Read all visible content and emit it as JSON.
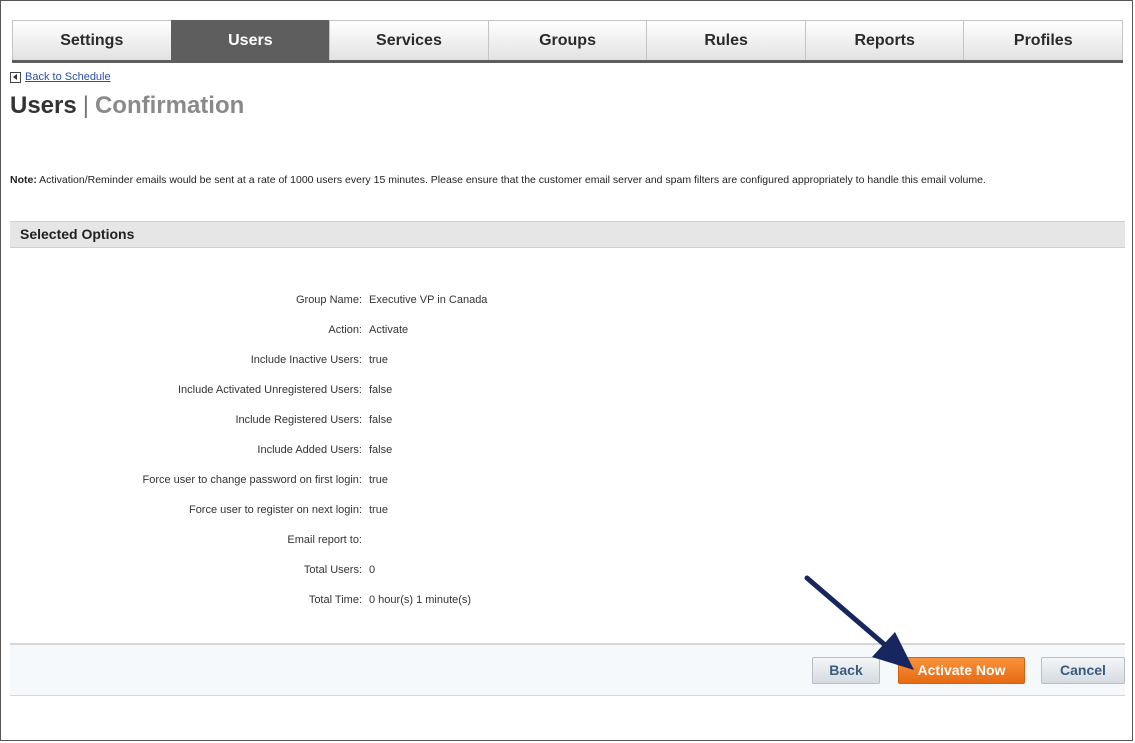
{
  "nav": {
    "tabs": [
      {
        "label": "Settings",
        "active": false
      },
      {
        "label": "Users",
        "active": true
      },
      {
        "label": "Services",
        "active": false
      },
      {
        "label": "Groups",
        "active": false
      },
      {
        "label": "Rules",
        "active": false
      },
      {
        "label": "Reports",
        "active": false
      },
      {
        "label": "Profiles",
        "active": false
      }
    ]
  },
  "page": {
    "back_link": "Back to Schedule",
    "title": "Users",
    "title_separator": "|",
    "subtitle": "Confirmation"
  },
  "note": {
    "label": "Note:",
    "text": " Activation/Reminder emails would be sent at a rate of 1000 users every 15 minutes. Please ensure that the customer email server and spam filters are configured appropriately to handle this email volume."
  },
  "selected_options": {
    "header": "Selected Options",
    "rows": [
      {
        "label": "Group Name:",
        "value": "Executive VP in Canada"
      },
      {
        "label": "Action:",
        "value": "Activate"
      },
      {
        "label": "Include Inactive Users:",
        "value": "true"
      },
      {
        "label": "Include Activated Unregistered Users:",
        "value": "false"
      },
      {
        "label": "Include Registered Users:",
        "value": "false"
      },
      {
        "label": "Include Added Users:",
        "value": "false"
      },
      {
        "label": "Force user to change password on first login:",
        "value": "true"
      },
      {
        "label": "Force user to register on next login:",
        "value": "true"
      },
      {
        "label": "Email report to:",
        "value": ""
      },
      {
        "label": "Total Users:",
        "value": "0"
      },
      {
        "label": "Total Time:",
        "value": "0 hour(s) 1 minute(s)"
      }
    ]
  },
  "actions": {
    "back_label": "Back",
    "activate_label": "Activate Now",
    "cancel_label": "Cancel"
  },
  "colors": {
    "active_tab": "#5e5e5e",
    "primary_button": "#f07c26",
    "arrow": "#17265e"
  }
}
